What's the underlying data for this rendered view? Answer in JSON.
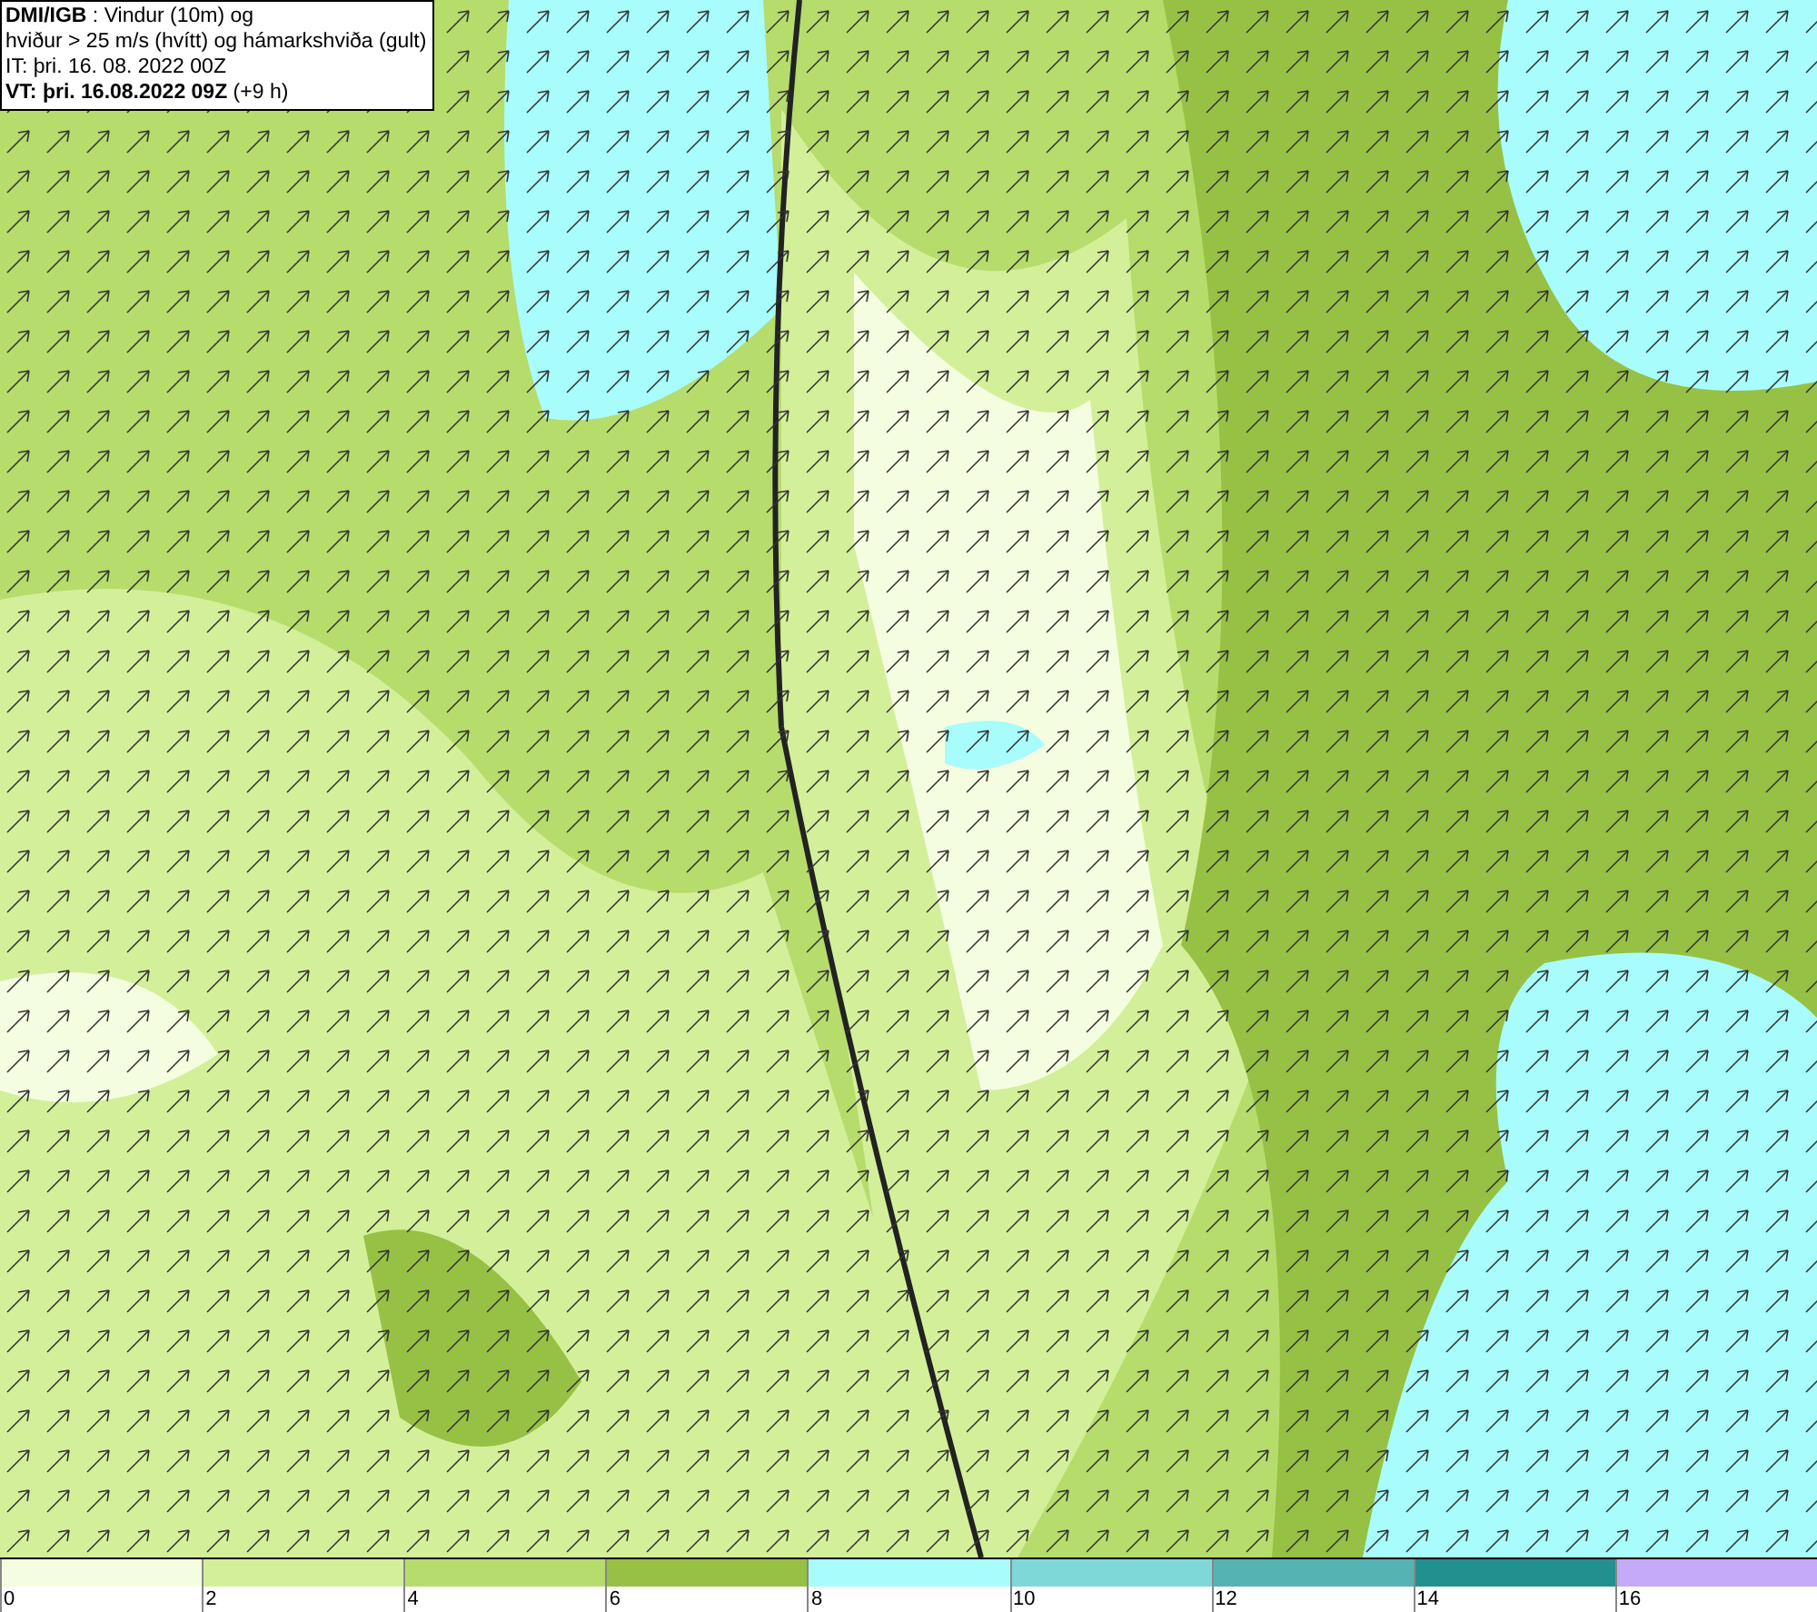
{
  "header": {
    "lines": [
      "**DMI/IGB** : Vindur (10m) og",
      "hviður > 25 m/s (hvítt) og hámarkshviða (gult)",
      "IT: þri. 16. 08. 2022 00Z",
      "**VT: þri. 16.08.2022 09Z** (+9 h)"
    ]
  },
  "legend": [
    {
      "label": "0",
      "color": "#f5fde0"
    },
    {
      "label": "2",
      "color": "#d4ef9a"
    },
    {
      "label": "4",
      "color": "#b6dc6c"
    },
    {
      "label": "6",
      "color": "#97c144"
    },
    {
      "label": "8",
      "color": "#a8fcfc"
    },
    {
      "label": "10",
      "color": "#7fd8d8"
    },
    {
      "label": "12",
      "color": "#56b3b3"
    },
    {
      "label": "14",
      "color": "#239090"
    },
    {
      "label": "16",
      "color": "#c4aaf8"
    }
  ]
}
